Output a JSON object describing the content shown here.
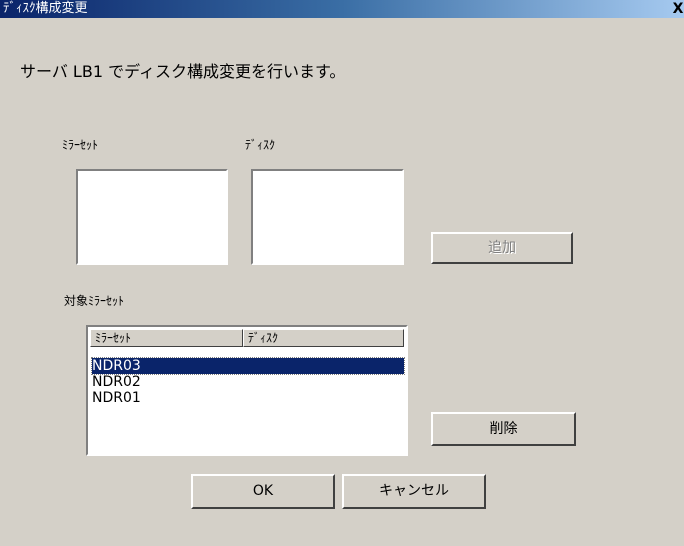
{
  "dialog": {
    "title": "ﾃﾞｨｽｸ構成変更",
    "close_glyph": "X"
  },
  "message": "サーバ LB1 でディスク構成変更を行います。",
  "mirrorset_label": "ﾐﾗｰｾｯﾄ",
  "disk_label": "ﾃﾞｨｽｸ",
  "add_button": {
    "label": "追加",
    "enabled": false
  },
  "target": {
    "label": "対象ﾐﾗｰｾｯﾄ",
    "columns": [
      "ﾐﾗｰｾｯﾄ",
      "ﾃﾞｨｽｸ"
    ],
    "rows": [
      "NDR03",
      "NDR02",
      "NDR01"
    ],
    "selected": "NDR03"
  },
  "delete_button": {
    "label": "削除"
  },
  "ok_button": {
    "label": "OK"
  },
  "cancel_button": {
    "label": "キャンセル"
  },
  "colors": {
    "face": "#d4d0c8",
    "title_bar": "#0a246a",
    "selection": "#0a246a"
  }
}
